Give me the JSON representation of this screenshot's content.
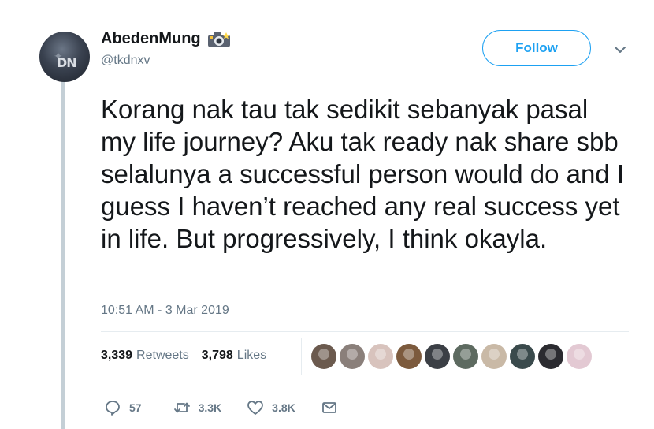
{
  "tweet": {
    "author": {
      "display_name": "AbedenMung",
      "handle": "@tkdnxv",
      "avatar_monogram": "DN"
    },
    "follow_label": "Follow",
    "text": "Korang nak tau tak sedikit sebanyak pasal my life journey? Aku tak ready nak share sbb selalunya a successful person would do and I guess I haven’t reached any real success yet in life. But progressively, I think okayla.",
    "timestamp": "10:51 AM - 3 Mar 2019",
    "stats": {
      "retweets_count": "3,339",
      "retweets_label": "Retweets",
      "likes_count": "3,798",
      "likes_label": "Likes"
    },
    "liker_avatar_colors": [
      "#6b5a4e",
      "#8a7f7a",
      "#d8c3bd",
      "#7c5a3d",
      "#3b3f45",
      "#5d6a60",
      "#c9b9a6",
      "#3a4a4c",
      "#2b2b30",
      "#e3c9d3"
    ],
    "actions": {
      "reply_count": "57",
      "retweet_count": "3.3K",
      "like_count": "3.8K"
    },
    "icons": {
      "name_badge": "camera-emoji-icon",
      "menu": "chevron-down-icon",
      "reply": "reply-icon",
      "retweet": "retweet-icon",
      "like": "heart-icon",
      "message": "envelope-icon"
    },
    "colors": {
      "accent": "#1da1f2",
      "secondary_text": "#657786",
      "primary_text": "#14171a",
      "thread_line": "#c4cfd6"
    }
  }
}
